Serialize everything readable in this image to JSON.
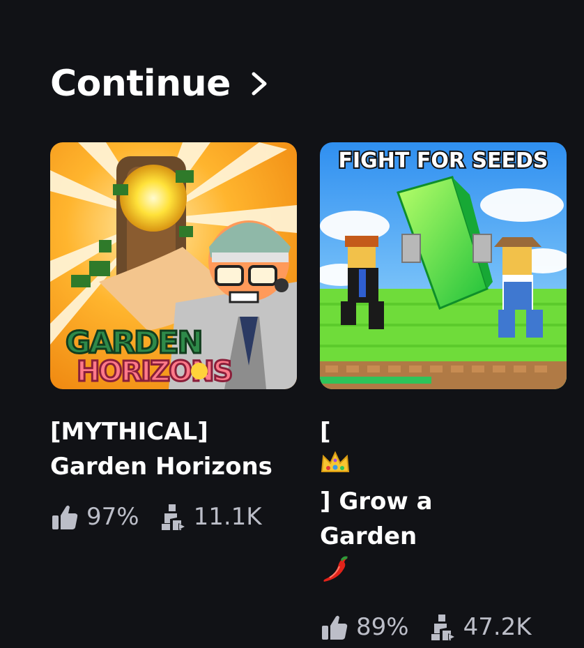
{
  "section": {
    "title": "Continue",
    "chevron_icon": "chevron-right-icon"
  },
  "games": [
    {
      "title_line1": "[MYTHICAL]",
      "title_line2": "Garden Horizons",
      "thumbnail_text_top": "GARDEN",
      "thumbnail_text_bottom": "HORIZONS",
      "rating": "97%",
      "players": "11.1K",
      "rating_icon": "thumbs-up-icon",
      "players_icon": "players-icon"
    },
    {
      "title_prefix": "[",
      "title_suffix": "] Grow a",
      "title_line2": "Garden",
      "title_emoji_1": "crown-emoji",
      "title_emoji_2": "chili-pepper-emoji",
      "thumbnail_banner": "FIGHT FOR SEEDS",
      "rating": "89%",
      "players": "47.2K",
      "rating_icon": "thumbs-up-icon",
      "players_icon": "players-icon"
    }
  ],
  "colors": {
    "background": "#111216",
    "text_primary": "#ffffff",
    "text_secondary": "#bcbec8"
  }
}
